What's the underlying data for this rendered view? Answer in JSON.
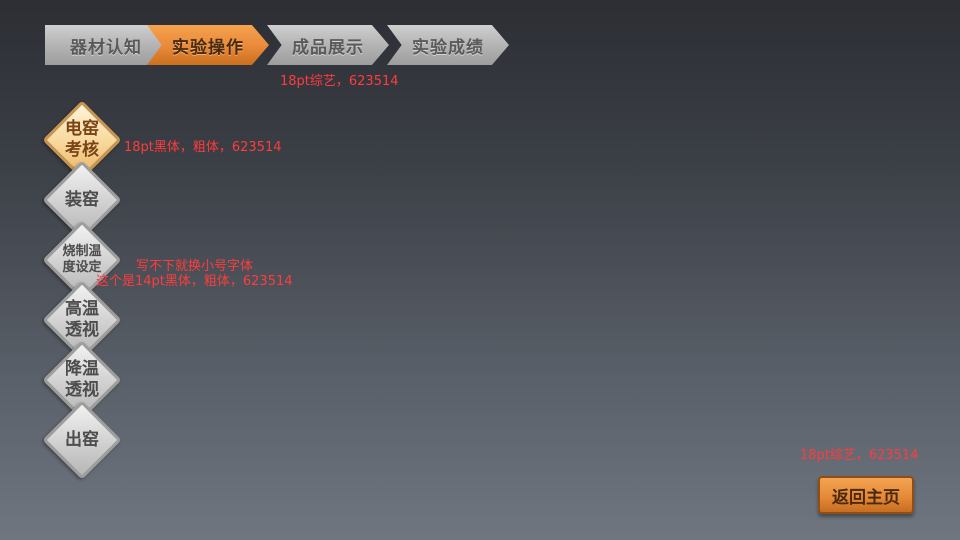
{
  "tabs": [
    {
      "label": "器材认知",
      "active": false
    },
    {
      "label": "实验操作",
      "active": true
    },
    {
      "label": "成品展示",
      "active": false
    },
    {
      "label": "实验成绩",
      "active": false
    }
  ],
  "annotations": {
    "tabs_note": "18pt综艺，623514",
    "diamond_note": "18pt黑体，粗体，623514",
    "small_note_1": "写不下就换小号字体",
    "small_note_2": "这个是14pt黑体，粗体，623514",
    "return_note": "18pt综艺，623514"
  },
  "steps": [
    {
      "line1": "电窑",
      "line2": "考核",
      "active": true
    },
    {
      "line1": "装窑",
      "line2": "",
      "active": false
    },
    {
      "line1": "烧制温",
      "line2": "度设定",
      "active": false
    },
    {
      "line1": "高温",
      "line2": "透视",
      "active": false
    },
    {
      "line1": "降温",
      "line2": "透视",
      "active": false
    },
    {
      "line1": "出窑",
      "line2": "",
      "active": false
    }
  ],
  "return_button": {
    "label": "返回主页"
  },
  "colors": {
    "accent": "#e8893a",
    "annotation": "#ff3c3c"
  }
}
